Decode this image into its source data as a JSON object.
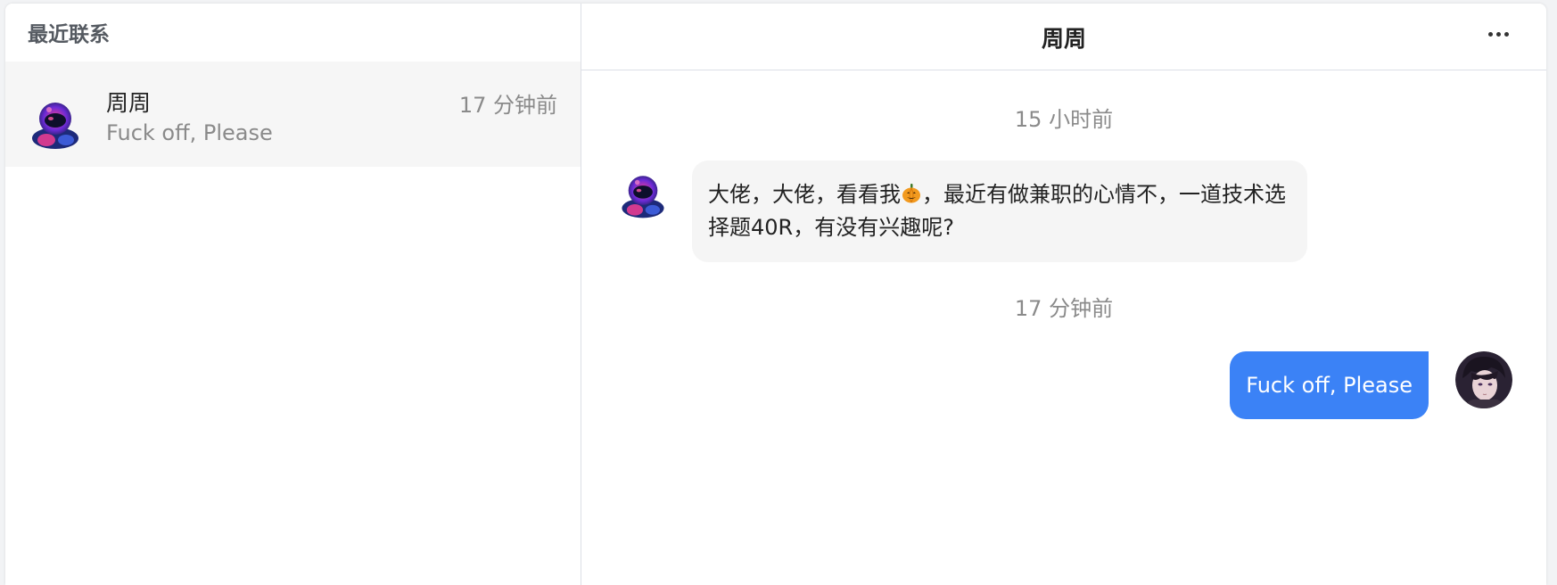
{
  "sidebar": {
    "title": "最近联系",
    "contacts": [
      {
        "name": "周周",
        "time": "17 分钟前",
        "preview": "Fuck off, Please",
        "avatar": "astronaut-avatar"
      }
    ]
  },
  "chat": {
    "title": "周周",
    "more_icon": "ellipsis-icon",
    "messages": [
      {
        "time_divider": "15 小时前",
        "side": "left",
        "avatar": "astronaut-avatar",
        "text_before_emoji": "大佬，大佬，看看我",
        "emoji": "pumpkin-icon",
        "text_after_emoji": "，最近有做兼职的心情不，一道技术选择题40R，有没有兴趣呢?"
      },
      {
        "time_divider": "17 分钟前",
        "side": "right",
        "avatar": "anime-user-avatar",
        "text": "Fuck off, Please"
      }
    ]
  },
  "colors": {
    "accent": "#3b82f6",
    "bubble_left": "#f5f5f5",
    "selected_item": "#f6f6f6",
    "muted_text": "#8a8a8a"
  }
}
